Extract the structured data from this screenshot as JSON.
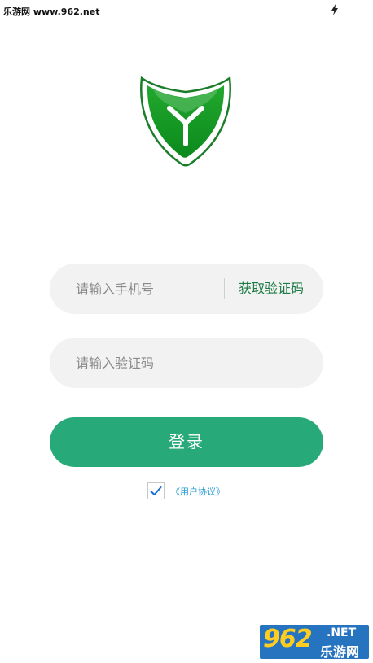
{
  "status_bar": {
    "left_text": "乐游网 www.962.net"
  },
  "form": {
    "phone_placeholder": "请输入手机号",
    "get_code_label": "获取验证码",
    "code_placeholder": "请输入验证码",
    "login_label": "登录",
    "agreement_checked": true,
    "agreement_label": "《用户协议》"
  },
  "watermark": {
    "number": "962",
    "suffix": ".NET",
    "name": "乐游网"
  },
  "colors": {
    "primary": "#27a97a",
    "logo_green": "#1a9a2a",
    "link_blue": "#2a9dd6"
  }
}
